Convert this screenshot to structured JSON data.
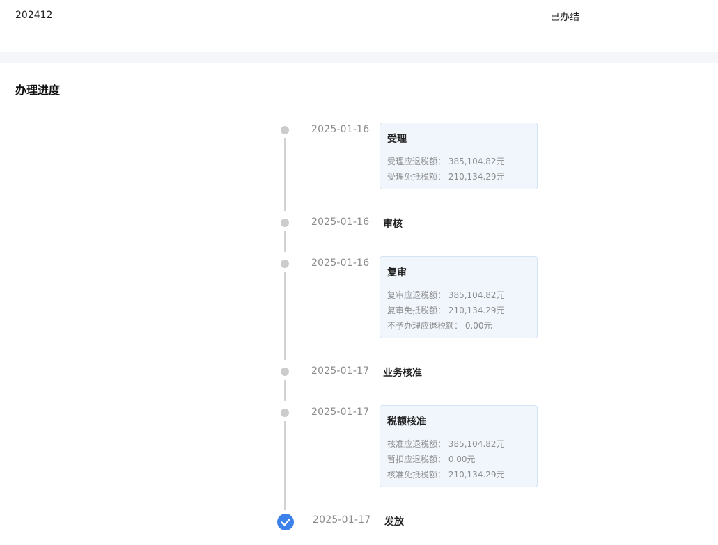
{
  "header": {
    "period": "202412",
    "status": "已办结"
  },
  "section": {
    "title": "办理进度"
  },
  "timeline": [
    {
      "date": "2025-01-16",
      "title": "受理",
      "rows": [
        "受理应退税额： 385,104.82元",
        "受理免抵税额： 210,134.29元"
      ]
    },
    {
      "date": "2025-01-16",
      "title": "审核"
    },
    {
      "date": "2025-01-16",
      "title": "复审",
      "rows": [
        "复审应退税额： 385,104.82元",
        "复审免抵税额： 210,134.29元",
        "不予办理应退税额： 0.00元"
      ]
    },
    {
      "date": "2025-01-17",
      "title": "业务核准"
    },
    {
      "date": "2025-01-17",
      "title": "税额核准",
      "rows": [
        "核准应退税额： 385,104.82元",
        "暂扣应退税额： 0.00元",
        "核准免抵税额： 210,134.29元"
      ]
    },
    {
      "date": "2025-01-17",
      "title": "发放",
      "completed": true,
      "icon": "check-circle-icon"
    }
  ],
  "colors": {
    "accent": "#3d82ea",
    "card_bg": "#f1f6fd",
    "dot": "#cccccc"
  }
}
